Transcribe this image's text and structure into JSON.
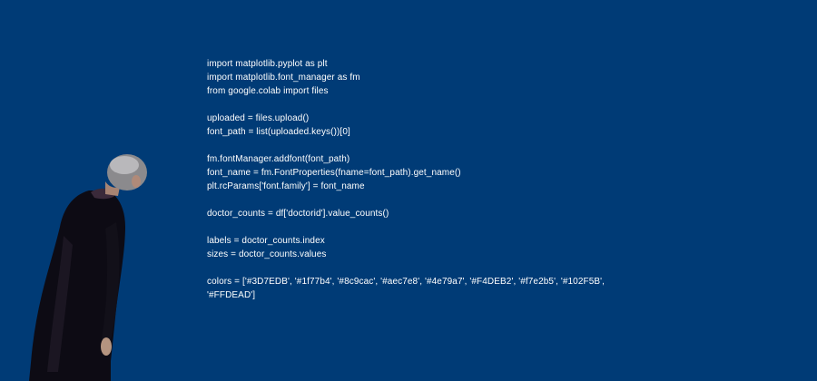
{
  "background_color": "#003b76",
  "text_color": "#ffffff",
  "code_lines": [
    "import matplotlib.pyplot as plt",
    "import matplotlib.font_manager as fm",
    "from google.colab import files",
    "",
    "uploaded = files.upload()",
    "font_path = list(uploaded.keys())[0]",
    "",
    "fm.fontManager.addfont(font_path)",
    "font_name = fm.FontProperties(fname=font_path).get_name()",
    "plt.rcParams['font.family'] = font_name",
    "",
    "doctor_counts = df['doctorid'].value_counts()",
    "",
    "labels = doctor_counts.index",
    "sizes = doctor_counts.values",
    "",
    "colors = ['#3D7EDB', '#1f77b4', '#8c9cac', '#aec7e8', '#4e79a7', '#F4DEB2', '#f7e2b5', '#102F5B',",
    "'#FFDEAD']"
  ],
  "figure": {
    "description_icon": "man-in-dark-coat-looking-up"
  }
}
